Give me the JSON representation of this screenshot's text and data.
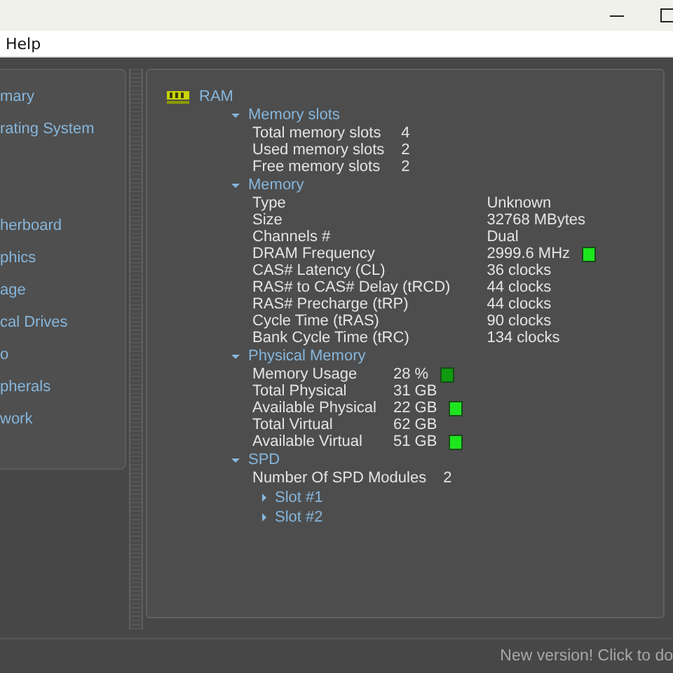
{
  "menu": {
    "items": [
      "Help"
    ]
  },
  "sidebar": {
    "items": [
      {
        "label": "mary"
      },
      {
        "label": "rating System"
      },
      {
        "label": "herboard"
      },
      {
        "label": "phics"
      },
      {
        "label": "age"
      },
      {
        "label": "cal Drives"
      },
      {
        "label": "o"
      },
      {
        "label": "pherals"
      },
      {
        "label": "work"
      }
    ]
  },
  "content": {
    "title": "RAM",
    "sections": [
      {
        "title": "Memory slots",
        "expanded": true,
        "rows": [
          {
            "label": "Total memory slots",
            "value": "4",
            "indicator": false
          },
          {
            "label": "Used memory slots",
            "value": "2",
            "indicator": false
          },
          {
            "label": "Free memory slots",
            "value": "2",
            "indicator": false
          }
        ]
      },
      {
        "title": "Memory",
        "expanded": true,
        "rows": [
          {
            "label": "Type",
            "value": "Unknown",
            "indicator": false
          },
          {
            "label": "Size",
            "value": "32768 MBytes",
            "indicator": false
          },
          {
            "label": "Channels #",
            "value": "Dual",
            "indicator": false
          },
          {
            "label": "DRAM Frequency",
            "value": "2999.6 MHz",
            "indicator": true
          },
          {
            "label": "CAS# Latency (CL)",
            "value": "36 clocks",
            "indicator": false
          },
          {
            "label": "RAS# to CAS# Delay (tRCD)",
            "value": "44 clocks",
            "indicator": false
          },
          {
            "label": "RAS# Precharge (tRP)",
            "value": "44 clocks",
            "indicator": false
          },
          {
            "label": "Cycle Time (tRAS)",
            "value": "90 clocks",
            "indicator": false
          },
          {
            "label": "Bank Cycle Time (tRC)",
            "value": "134 clocks",
            "indicator": false
          }
        ]
      },
      {
        "title": "Physical Memory",
        "expanded": true,
        "rows": [
          {
            "label": "Memory Usage",
            "value": "28 %",
            "indicator": true
          },
          {
            "label": "Total Physical",
            "value": "31 GB",
            "indicator": false
          },
          {
            "label": "Available Physical",
            "value": "22 GB",
            "indicator": true
          },
          {
            "label": "Total Virtual",
            "value": "62 GB",
            "indicator": false
          },
          {
            "label": "Available Virtual",
            "value": "51 GB",
            "indicator": true
          }
        ]
      },
      {
        "title": "SPD",
        "expanded": true,
        "rows": [
          {
            "label": "Number Of SPD Modules",
            "value": "2",
            "indicator": false
          }
        ],
        "children": [
          {
            "title": "Slot #1",
            "expanded": false
          },
          {
            "title": "Slot #2",
            "expanded": false
          }
        ]
      }
    ]
  },
  "status_bar": {
    "text": "New version! Click to do"
  }
}
